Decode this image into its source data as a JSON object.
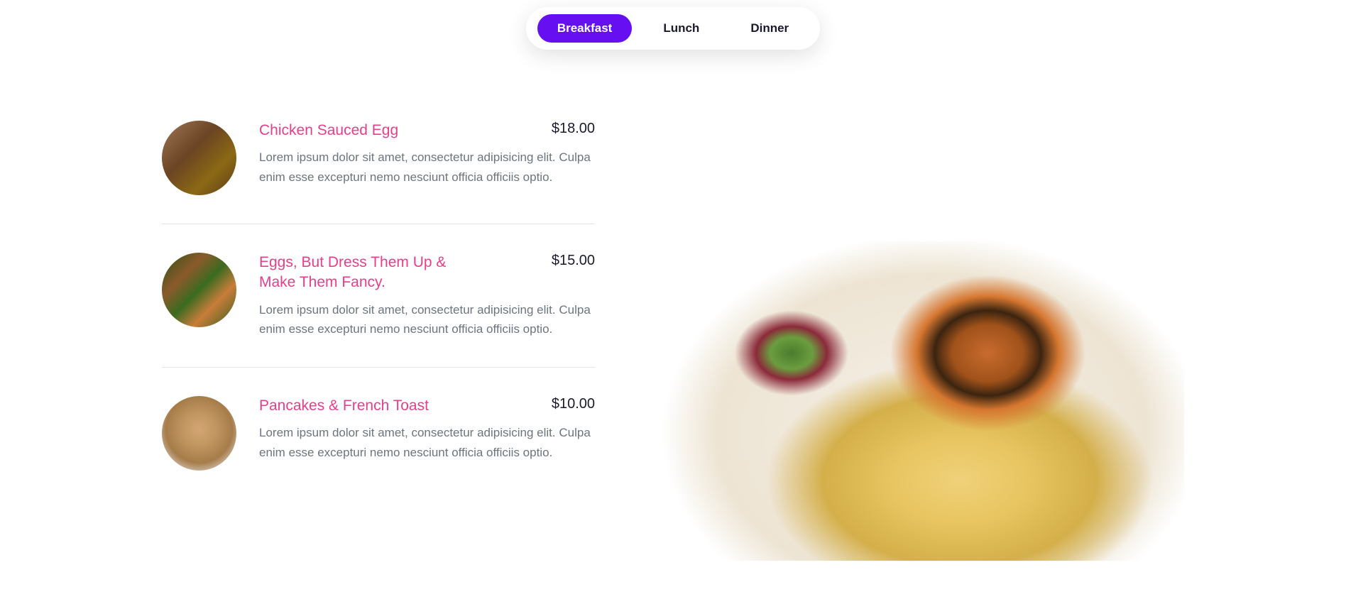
{
  "tabs": {
    "items": [
      {
        "label": "Breakfast"
      },
      {
        "label": "Lunch"
      },
      {
        "label": "Dinner"
      }
    ],
    "active_index": 0
  },
  "menu": {
    "items": [
      {
        "name": "Chicken Sauced Egg",
        "price": "$18.00",
        "desc": "Lorem ipsum dolor sit amet, consectetur adipisicing elit. Culpa enim esse excepturi nemo nesciunt officia officiis optio."
      },
      {
        "name": "Eggs, But Dress Them Up & Make Them Fancy.",
        "price": "$15.00",
        "desc": "Lorem ipsum dolor sit amet, consectetur adipisicing elit. Culpa enim esse excepturi nemo nesciunt officia officiis optio."
      },
      {
        "name": "Pancakes & French Toast",
        "price": "$10.00",
        "desc": "Lorem ipsum dolor sit amet, consectetur adipisicing elit. Culpa enim esse excepturi nemo nesciunt officia officiis optio."
      }
    ]
  }
}
